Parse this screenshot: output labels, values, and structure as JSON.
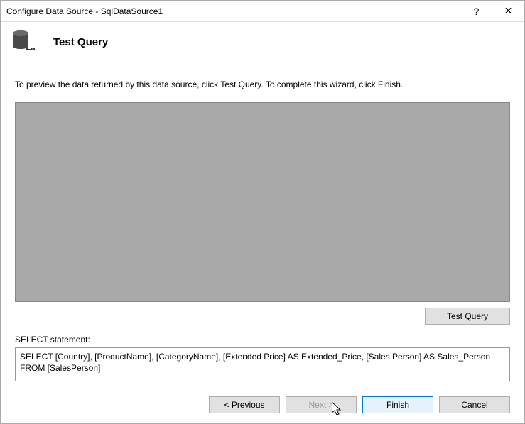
{
  "titlebar": {
    "title": "Configure Data Source - SqlDataSource1",
    "help": "?",
    "close": "✕"
  },
  "header": {
    "heading": "Test Query"
  },
  "content": {
    "instruction": "To preview the data returned by this data source, click Test Query. To complete this wizard, click Finish.",
    "test_query_button": "Test Query",
    "select_label": "SELECT statement:",
    "select_statement": "SELECT [Country], [ProductName], [CategoryName], [Extended Price] AS Extended_Price, [Sales Person] AS Sales_Person FROM [SalesPerson]"
  },
  "footer": {
    "previous": "< Previous",
    "next": "Next >",
    "finish": "Finish",
    "cancel": "Cancel"
  }
}
